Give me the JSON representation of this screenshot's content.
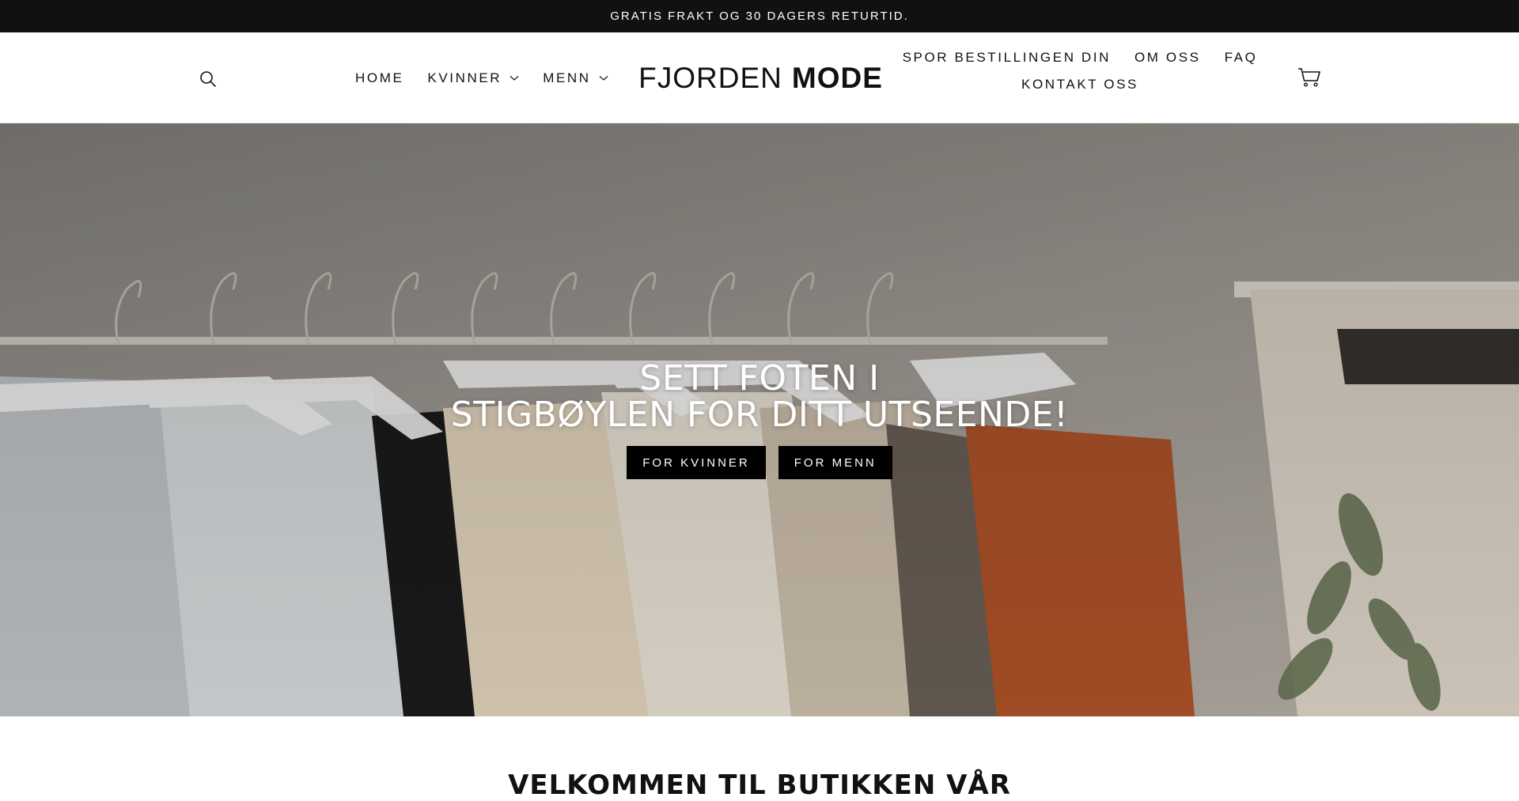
{
  "announcement": {
    "text": "GRATIS FRAKT OG 30 DAGERS RETURTID."
  },
  "header": {
    "logo_light": "FJORDEN",
    "logo_bold": "MODE",
    "nav_left": [
      {
        "label": "HOME",
        "has_dropdown": false
      },
      {
        "label": "KVINNER",
        "has_dropdown": true
      },
      {
        "label": "MENN",
        "has_dropdown": true
      }
    ],
    "nav_right": [
      {
        "label": "SPOR BESTILLINGEN DIN"
      },
      {
        "label": "OM OSS"
      },
      {
        "label": "FAQ"
      },
      {
        "label": "KONTAKT OSS"
      }
    ],
    "icons": {
      "search": "search-icon",
      "cart": "cart-icon",
      "dropdown": "chevron-down-icon"
    }
  },
  "hero": {
    "title_line1": "SETT FOTEN I",
    "title_line2": "STIGBØYLEN FOR DITT UTSEENDE!",
    "button_women": "FOR KVINNER",
    "button_men": "FOR MENN"
  },
  "welcome": {
    "heading": "VELKOMMEN TIL BUTIKKEN VÅR"
  },
  "colors": {
    "announcement_bg": "#111111",
    "button_bg": "#000000",
    "text": "#111111"
  }
}
